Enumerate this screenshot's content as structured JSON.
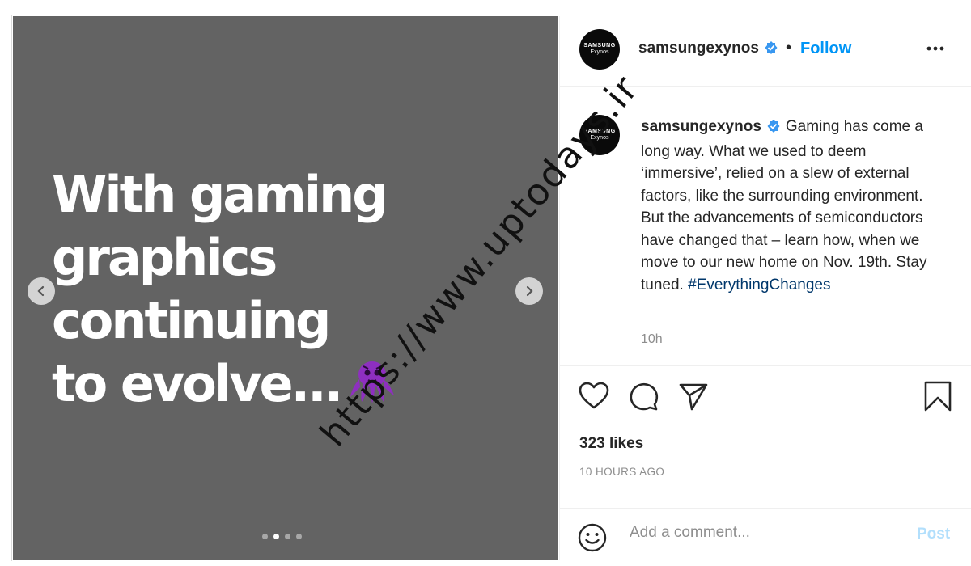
{
  "media": {
    "headline_lines": [
      "With gaming",
      "graphics",
      "continuing",
      "to evolve..."
    ],
    "emoji": "octopus-emoji",
    "slide_count": 4,
    "active_slide": 2
  },
  "header": {
    "avatar_brand": "SAMSUNG",
    "avatar_sub": "Exynos",
    "username": "samsungexynos",
    "separator": "•",
    "follow_label": "Follow"
  },
  "caption": {
    "username": "samsungexynos",
    "text": "Gaming has come a long way. What we used to deem ‘immersive’, relied on a slew of external factors, like the surrounding environment. But the advancements of semiconductors have changed that – learn how, when we move to our new home on Nov. 19th. Stay tuned.",
    "hashtag": "#EverythingChanges",
    "time_ago": "10h"
  },
  "stats": {
    "likes": "323 likes",
    "posted": "10 HOURS AGO"
  },
  "comment": {
    "placeholder": "Add a comment...",
    "post_label": "Post"
  },
  "watermark": "https://www.uptodays.ir",
  "colors": {
    "media_bg": "#636363",
    "link_blue": "#0095f6",
    "hashtag": "#00376b",
    "verified": "#3897f0",
    "emoji_purple": "#8e2fc0"
  }
}
